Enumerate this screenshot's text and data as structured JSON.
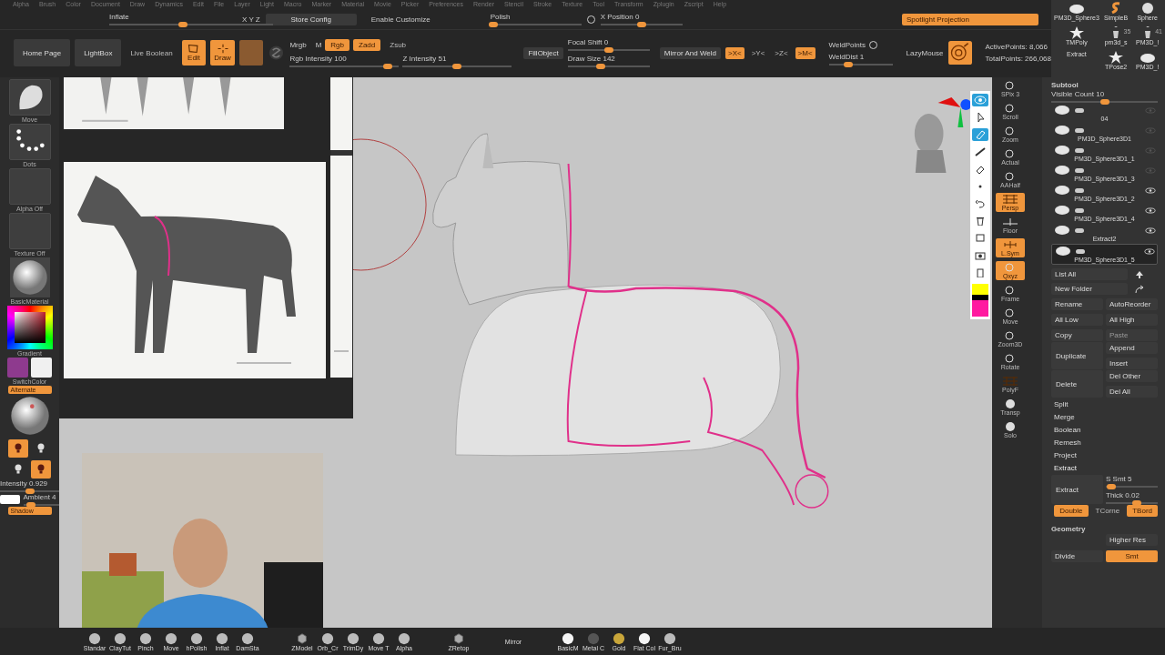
{
  "menu": [
    "Alpha",
    "Brush",
    "Color",
    "Document",
    "Draw",
    "Dynamics",
    "Edit",
    "File",
    "Layer",
    "Light",
    "Macro",
    "Marker",
    "Material",
    "Movie",
    "Picker",
    "Preferences",
    "Render",
    "Stencil",
    "Stroke",
    "Texture",
    "Tool",
    "Transform",
    "Zplugin",
    "Zscript",
    "Help"
  ],
  "top_bar": {
    "inflate": {
      "label": "Inflate",
      "level": 0.45
    },
    "xyz": "X Y Z",
    "store_config": "Store Config",
    "enable_customize": "Enable Customize",
    "polish": {
      "label": "Polish",
      "level": 0.03
    },
    "x_position": {
      "label": "X Position 0",
      "level": 0.5
    },
    "spotlight": "Spotlight Projection"
  },
  "toolbar": {
    "nav": [
      "Home Page",
      "LightBox",
      "Live Boolean"
    ],
    "modes": [
      {
        "label": "Edit",
        "selected": true
      },
      {
        "label": "Draw",
        "selected": true
      }
    ],
    "mrgb": "Mrgb",
    "m": "M",
    "rgb": {
      "label": "Rgb",
      "selected": true
    },
    "zadd": {
      "label": "Zadd",
      "selected": true
    },
    "zsub": {
      "label": "Zsub",
      "selected": false
    },
    "rgb_intensity": {
      "label": "Rgb Intensity 100",
      "level": 0.9
    },
    "z_intensity": {
      "label": "Z Intensity 51",
      "level": 0.5
    },
    "fill_object": "FillObject",
    "focal_shift": {
      "label": "Focal Shift 0",
      "level": 0.5
    },
    "draw_size": {
      "label": "Draw Size 142",
      "level": 0.4
    },
    "mirror_and_weld": "Mirror And Weld",
    "axes": [
      {
        "label": ">X<",
        "selected": true
      },
      {
        "label": ">Y<",
        "selected": false
      },
      {
        "label": ">Z<",
        "selected": false
      },
      {
        "label": ">M<",
        "selected": true
      }
    ],
    "weld_points": "WeldPoints",
    "weld_dist": {
      "label": "WeldDist 1",
      "level": 0.3
    },
    "lazy_mouse": "LazyMouse",
    "active_points": "ActivePoints: 8,066",
    "total_points": "TotalPoints: 266,068"
  },
  "tools": [
    {
      "label": "PM3D_Sphere3",
      "kind": "blob"
    },
    {
      "label": "SimpleB",
      "kind": "s"
    },
    {
      "label": "Sphere",
      "kind": "sphere"
    },
    {
      "label": "TMPoly",
      "kind": "star"
    },
    {
      "label": "pm3d_s",
      "kind": "figure",
      "count": "35"
    },
    {
      "label": "PM3D_!",
      "kind": "figure",
      "count": "41"
    },
    {
      "label": "Extract",
      "kind": "none"
    },
    {
      "label": "TPose2",
      "kind": "star"
    },
    {
      "label": "PM3D_!",
      "kind": "blob"
    }
  ],
  "left": {
    "brush": "Move",
    "stroke": "Dots",
    "alpha": "Alpha Off",
    "texture": "Texture Off",
    "material": "BasicMaterial",
    "gradient": "Gradient",
    "switch_color": {
      "label": "SwitchColor",
      "colors": [
        {
          "color": "#8e3a8e"
        },
        {
          "color": "#f0f0f0"
        }
      ]
    },
    "alternate": "Alternate",
    "lights": [
      {
        "selected": true
      },
      {
        "selected": false
      },
      {
        "selected": false
      },
      {
        "selected": true
      }
    ],
    "intensity": {
      "label": "Intensity 0.929",
      "level": 0.5
    },
    "ambient": {
      "label": "Ambient 4",
      "level": 0.2
    },
    "shadow": "Shadow"
  },
  "shelf": [
    {
      "label": "SPix 3",
      "selected": false
    },
    {
      "label": "Scroll",
      "selected": false
    },
    {
      "label": "Zoom",
      "selected": false
    },
    {
      "label": "Actual",
      "selected": false
    },
    {
      "label": "AAHalf",
      "selected": false
    },
    {
      "label": "Persp",
      "selected": true
    },
    {
      "label": "Floor",
      "selected": false
    },
    {
      "label": "L.Sym",
      "selected": true
    },
    {
      "label": "Qxyz",
      "selected": true
    },
    {
      "label": "Frame",
      "selected": false
    },
    {
      "label": "Move",
      "selected": false
    },
    {
      "label": "Zoom3D",
      "selected": false
    },
    {
      "label": "Rotate",
      "selected": false
    },
    {
      "label": "PolyF",
      "selected": false
    },
    {
      "label": "Transp",
      "selected": false
    },
    {
      "label": "Solo",
      "selected": false
    }
  ],
  "subtool": {
    "title": "Subtool",
    "visible_count": {
      "label": "Visible Count 10",
      "level": 0.5
    },
    "rows": [
      {
        "name": "04",
        "visible": false,
        "selected": false
      },
      {
        "name": "PM3D_Sphere3D1",
        "visible": false,
        "selected": false
      },
      {
        "name": "PM3D_Sphere3D1_1",
        "visible": false,
        "selected": false
      },
      {
        "name": "PM3D_Sphere3D1_3",
        "visible": false,
        "selected": false
      },
      {
        "name": "PM3D_Sphere3D1_2",
        "visible": true,
        "selected": false
      },
      {
        "name": "PM3D_Sphere3D1_4",
        "visible": true,
        "selected": false
      },
      {
        "name": "Extract2",
        "visible": true,
        "selected": false
      },
      {
        "name": "PM3D_Sphere3D1_5",
        "visible": true,
        "selected": true
      }
    ],
    "list_all": "List All",
    "new_folder": "New Folder",
    "pairs": [
      [
        {
          "label": "Rename",
          "disabled": false
        },
        {
          "label": "AutoReorder",
          "disabled": false
        }
      ],
      [
        {
          "label": "All Low",
          "disabled": false
        },
        {
          "label": "All High",
          "disabled": false
        }
      ],
      [
        {
          "label": "Copy",
          "disabled": false
        },
        {
          "label": "Paste",
          "disabled": true
        }
      ]
    ],
    "duplicate": "Duplicate",
    "dup_pair": [
      "Append",
      "Insert"
    ],
    "delete": "Delete",
    "del_pair": [
      "Del Other",
      "Del All"
    ],
    "items": [
      "Split",
      "Merge",
      "Boolean",
      "Remesh",
      "Project"
    ],
    "extract_title": "Extract",
    "extract_button": "Extract",
    "s_smt": {
      "label": "S Smt 5",
      "level": 0.1
    },
    "thick": {
      "label": "Thick 0.02",
      "level": 0.6
    },
    "extract_options": [
      {
        "label": "Double",
        "selected": true
      },
      {
        "label": "TCorne",
        "selected": false
      },
      {
        "label": "TBord",
        "selected": true
      }
    ],
    "geometry": "Geometry",
    "higher_res": "Higher Res",
    "divide": "Divide",
    "smt": {
      "label": "Smt",
      "selected": true
    }
  },
  "bottom": [
    {
      "label": "Standar",
      "kind": "brush"
    },
    {
      "label": "ClayTut",
      "kind": "brush"
    },
    {
      "label": "Pinch",
      "kind": "brush"
    },
    {
      "label": "Move",
      "kind": "brush"
    },
    {
      "label": "hPolish",
      "kind": "brush"
    },
    {
      "label": "Inflat",
      "kind": "brush"
    },
    {
      "label": "DamSta",
      "kind": "brush"
    },
    {
      "label": "ZModel",
      "kind": "cube"
    },
    {
      "label": "Orb_Cr",
      "kind": "brush"
    },
    {
      "label": "TrimDy",
      "kind": "brush"
    },
    {
      "label": "Move T",
      "kind": "brush"
    },
    {
      "label": "Alpha",
      "kind": "brush"
    },
    {
      "label": "ZRetop",
      "kind": "cube"
    },
    {
      "label": "Mirror",
      "kind": "text"
    },
    {
      "label": "BasicM",
      "kind": "white"
    },
    {
      "label": "Metal C",
      "kind": "dark"
    },
    {
      "label": "Gold",
      "kind": "gold"
    },
    {
      "label": "Flat Col",
      "kind": "white"
    },
    {
      "label": "Fur_Bru",
      "kind": "brush"
    }
  ]
}
